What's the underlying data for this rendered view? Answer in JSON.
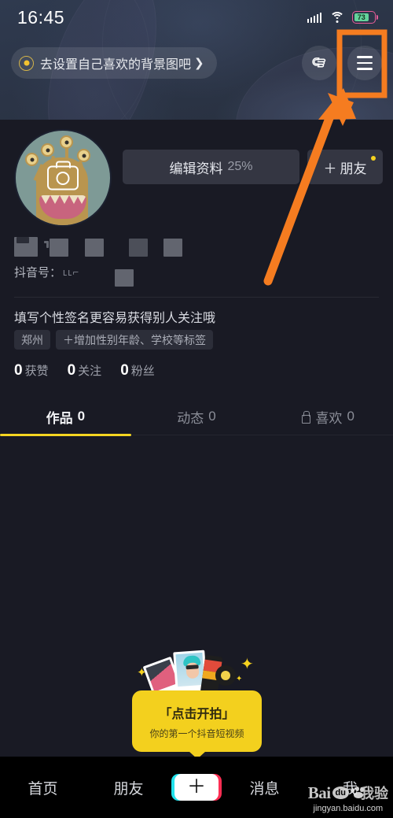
{
  "status_bar": {
    "time": "16:45",
    "battery_percent": "73",
    "icons": [
      "signal-icon",
      "wifi-icon",
      "battery-icon"
    ]
  },
  "header": {
    "background_pill_label": "去设置自己喜欢的背景图吧",
    "background_pill_chevron": "❯",
    "hand_icon": "pointing-hand-icon",
    "menu_icon": "hamburger-menu-icon"
  },
  "profile": {
    "avatar_alt": "monster-avatar",
    "avatar_camera_icon": "camera-icon",
    "edit_profile_label": "编辑资料",
    "edit_profile_percent": "25%",
    "add_friend_plus": "＋",
    "add_friend_label": "朋友",
    "douyin_id_label": "抖音号：",
    "douyin_id_value": "ʟʟ⌐",
    "bio_placeholder": "填写个性签名更容易获得别人关注哦",
    "tags": [
      "郑州",
      "＋增加性别年龄、学校等标签"
    ],
    "stats": [
      {
        "num": "0",
        "label": "获赞"
      },
      {
        "num": "0",
        "label": "关注"
      },
      {
        "num": "0",
        "label": "粉丝"
      }
    ]
  },
  "tabs": [
    {
      "label": "作品",
      "count": "0",
      "active": true,
      "icon": ""
    },
    {
      "label": "动态",
      "count": "0",
      "active": false,
      "icon": ""
    },
    {
      "label": "喜欢",
      "count": "0",
      "active": false,
      "icon": "lock-icon"
    }
  ],
  "tooltip": {
    "title": "「点击开拍」",
    "subtitle": "你的第一个抖音短视频",
    "background_color": "#f3d01e"
  },
  "bottom_nav": {
    "items": [
      "首页",
      "朋友"
    ],
    "create_button_glyph": "＋",
    "right_items": [
      "消息",
      "我"
    ]
  },
  "watermark": {
    "brand": "Bai",
    "brand_suffix": "du",
    "brand_cn": "我验",
    "url": "jingyan.baidu.com"
  },
  "annotation": {
    "color": "#f57c20",
    "shape": "highlight-rectangle-with-arrow",
    "target": "hamburger-menu-icon"
  },
  "theme": {
    "page_background": "#191a24",
    "banner_background": "#2b3446",
    "accent_yellow": "#f4d521",
    "nav_background": "#000000"
  }
}
